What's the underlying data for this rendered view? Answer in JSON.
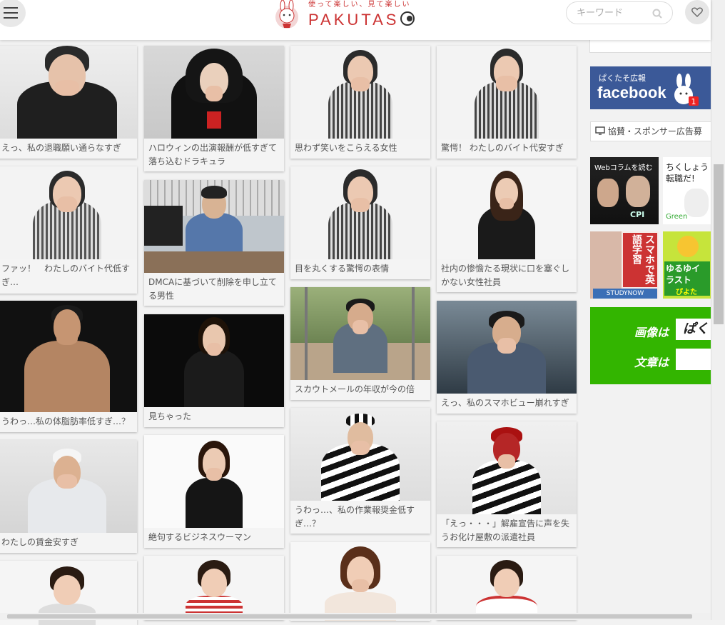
{
  "header": {
    "tagline": "使って楽しい、見て楽しい",
    "brand": "PAKUTAS",
    "search_placeholder": "キーワード"
  },
  "cards": [
    {
      "caption": "えっ、私の退職願い通らなすぎ"
    },
    {
      "caption": "ハロウィンの出演報酬が低すぎて落ち込むドラキュラ"
    },
    {
      "caption": "思わず笑いをこらえる女性"
    },
    {
      "caption": "驚愕！ わたしのバイト代安すぎ"
    },
    {
      "caption": "ファッ！　わたしのバイト代低すぎ…"
    },
    {
      "caption": "DMCAに基づいて削除を申し立てる男性"
    },
    {
      "caption": "目を丸くする驚愕の表情"
    },
    {
      "caption": "社内の惨憺たる現状に口を塞ぐしかない女性社員"
    },
    {
      "caption": "うわっ…私の体脂肪率低すぎ…？"
    },
    {
      "caption": "見ちゃった"
    },
    {
      "caption": "スカウトメールの年収が今の倍"
    },
    {
      "caption": "えっ、私のスマホビュー崩れすぎ"
    },
    {
      "caption": "わたしの賃金安すぎ"
    },
    {
      "caption": "絶句するビジネスウーマン"
    },
    {
      "caption": "うわっ…、私の作業報奨金低すぎ…？"
    },
    {
      "caption": "「えっ・・・」解雇宣告に声を失うお化け屋敷の派遣社員"
    },
    {
      "caption": ""
    },
    {
      "caption": ""
    },
    {
      "caption": ""
    },
    {
      "caption": ""
    }
  ],
  "sidebar": {
    "fb_small": "ぱくたそ広報",
    "fb_big": "facebook",
    "fb_badge": "1",
    "sponsor_label": "協賛・スポンサー広告募",
    "ad1_text": "Webコラムを読む",
    "ad1_brand": "CPI",
    "ad2_text": "ちくしょう転職だ!",
    "ad2_brand": "Green",
    "ad3_text": "スマホで英語学習",
    "ad3_brand": "STUDYNOW",
    "ad4_text": "ゆるゆイラスト",
    "ad4_brand": "ぴよた",
    "green_row1": "画像は",
    "green_row1_box": "ぱく",
    "green_row2": "文章は",
    "green_row2_box": ""
  },
  "colors": {
    "accent": "#cc3333",
    "facebook": "#3b5998",
    "green_ad": "#33b500"
  }
}
